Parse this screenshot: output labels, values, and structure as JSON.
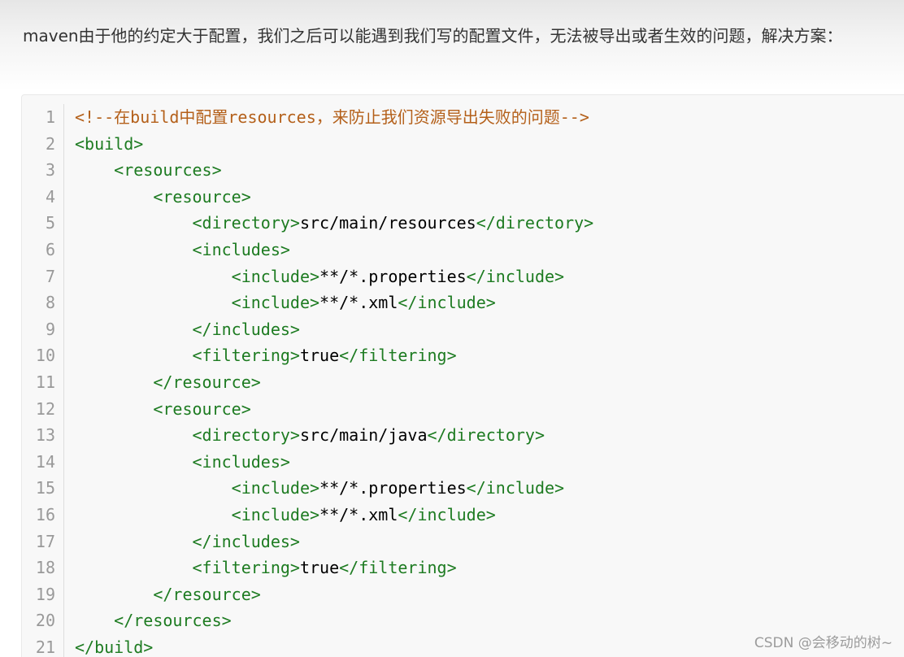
{
  "intro_text": "maven由于他的约定大于配置，我们之后可以能遇到我们写的配置文件，无法被导出或者生效的问题，解决方案：",
  "watermark": "CSDN @会移动的树~",
  "colors": {
    "tag": "#1d7b21",
    "comment": "#b4601a",
    "line_number": "#999999",
    "code_bg": "#f8f8f8"
  },
  "code": {
    "language": "xml",
    "lines": [
      {
        "n": "1",
        "indent": "",
        "open": "<!--在build中配置resources，来防止我们资源导出失败的问题-->",
        "text": "",
        "close": "",
        "comment": true
      },
      {
        "n": "2",
        "indent": "",
        "open": "<build>",
        "text": "",
        "close": ""
      },
      {
        "n": "3",
        "indent": "    ",
        "open": "<resources>",
        "text": "",
        "close": ""
      },
      {
        "n": "4",
        "indent": "        ",
        "open": "<resource>",
        "text": "",
        "close": ""
      },
      {
        "n": "5",
        "indent": "            ",
        "open": "<directory>",
        "text": "src/main/resources",
        "close": "</directory>"
      },
      {
        "n": "6",
        "indent": "            ",
        "open": "<includes>",
        "text": "",
        "close": ""
      },
      {
        "n": "7",
        "indent": "                ",
        "open": "<include>",
        "text": "**/*.properties",
        "close": "</include>"
      },
      {
        "n": "8",
        "indent": "                ",
        "open": "<include>",
        "text": "**/*.xml",
        "close": "</include>"
      },
      {
        "n": "9",
        "indent": "            ",
        "open": "</includes>",
        "text": "",
        "close": ""
      },
      {
        "n": "10",
        "indent": "            ",
        "open": "<filtering>",
        "text": "true",
        "close": "</filtering>"
      },
      {
        "n": "11",
        "indent": "        ",
        "open": "</resource>",
        "text": "",
        "close": ""
      },
      {
        "n": "12",
        "indent": "        ",
        "open": "<resource>",
        "text": "",
        "close": ""
      },
      {
        "n": "13",
        "indent": "            ",
        "open": "<directory>",
        "text": "src/main/java",
        "close": "</directory>"
      },
      {
        "n": "14",
        "indent": "            ",
        "open": "<includes>",
        "text": "",
        "close": ""
      },
      {
        "n": "15",
        "indent": "                ",
        "open": "<include>",
        "text": "**/*.properties",
        "close": "</include>"
      },
      {
        "n": "16",
        "indent": "                ",
        "open": "<include>",
        "text": "**/*.xml",
        "close": "</include>"
      },
      {
        "n": "17",
        "indent": "            ",
        "open": "</includes>",
        "text": "",
        "close": ""
      },
      {
        "n": "18",
        "indent": "            ",
        "open": "<filtering>",
        "text": "true",
        "close": "</filtering>"
      },
      {
        "n": "19",
        "indent": "        ",
        "open": "</resource>",
        "text": "",
        "close": ""
      },
      {
        "n": "20",
        "indent": "    ",
        "open": "</resources>",
        "text": "",
        "close": ""
      },
      {
        "n": "21",
        "indent": "",
        "open": "</build>",
        "text": "",
        "close": ""
      }
    ]
  }
}
